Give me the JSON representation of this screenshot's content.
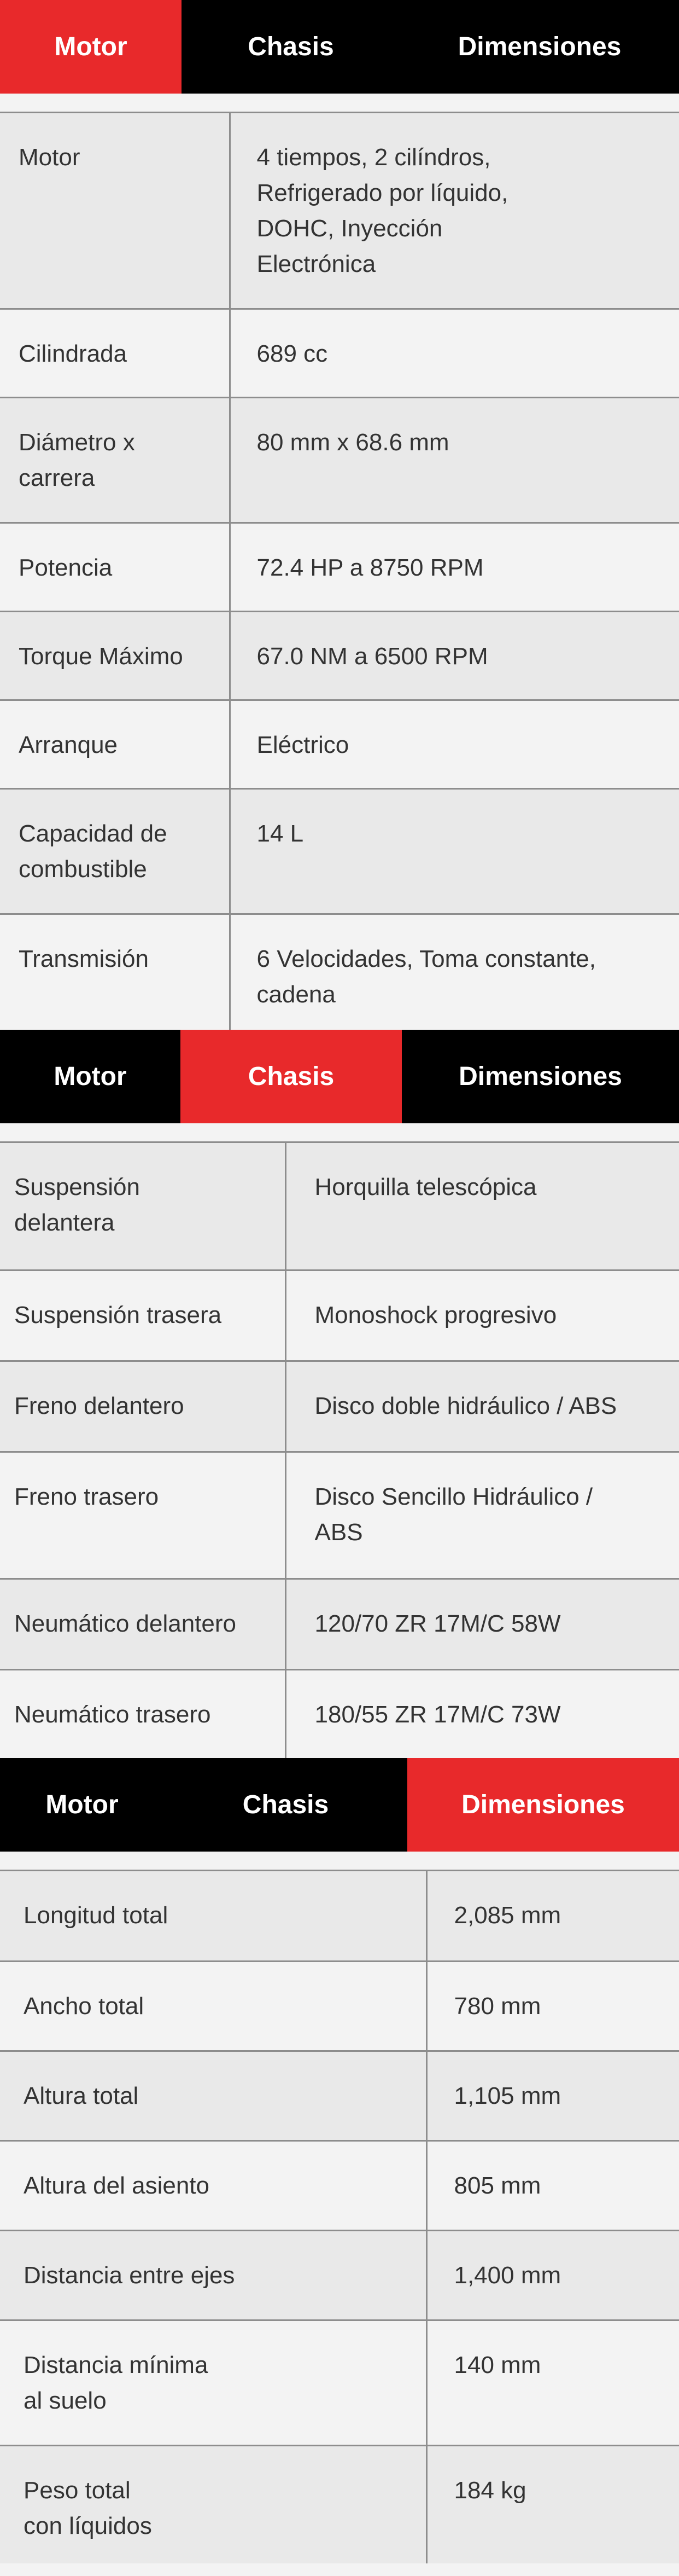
{
  "tabs": {
    "motor": "Motor",
    "chasis": "Chasis",
    "dimensiones": "Dimensiones"
  },
  "colors": {
    "active_tab": "#e8292b",
    "tab_bar": "#000000",
    "row_odd": "#e9e9e9",
    "row_even": "#f3f3f3",
    "divider": "#8d8d8d"
  },
  "motor": {
    "active_tab": "Motor",
    "rows": [
      {
        "label": "Motor",
        "value": "4 tiempos, 2 cilíndros,\nRefrigerado por líquido,\nDOHC, Inyección\nElectrónica"
      },
      {
        "label": "Cilindrada",
        "value": "689 cc"
      },
      {
        "label": "Diámetro x\ncarrera",
        "value": "80 mm x 68.6 mm"
      },
      {
        "label": "Potencia",
        "value": "72.4 HP a 8750 RPM"
      },
      {
        "label": "Torque Máximo",
        "value": "67.0 NM a 6500 RPM"
      },
      {
        "label": "Arranque",
        "value": "Eléctrico"
      },
      {
        "label": "Capacidad de\ncombustible",
        "value": "14 L"
      },
      {
        "label": "Transmisión",
        "value": "6 Velocidades, Toma constante,\ncadena"
      }
    ]
  },
  "chasis": {
    "active_tab": "Chasis",
    "rows": [
      {
        "label": "Suspensión\ndelantera",
        "value": "Horquilla telescópica"
      },
      {
        "label": "Suspensión trasera",
        "value": "Monoshock progresivo"
      },
      {
        "label": "Freno delantero",
        "value": "Disco doble hidráulico / ABS"
      },
      {
        "label": "Freno trasero",
        "value": "Disco Sencillo Hidráulico /\nABS"
      },
      {
        "label": "Neumático delantero",
        "value": "120/70 ZR 17M/C 58W"
      },
      {
        "label": "Neumático trasero",
        "value": "180/55 ZR 17M/C 73W"
      }
    ]
  },
  "dimensiones": {
    "active_tab": "Dimensiones",
    "rows": [
      {
        "label": "Longitud total",
        "value": "2,085 mm"
      },
      {
        "label": "Ancho total",
        "value": "780 mm"
      },
      {
        "label": "Altura total",
        "value": "1,105 mm"
      },
      {
        "label": "Altura del asiento",
        "value": "805 mm"
      },
      {
        "label": "Distancia entre ejes",
        "value": "1,400 mm"
      },
      {
        "label": "Distancia mínima\nal suelo",
        "value": "140 mm"
      },
      {
        "label": "Peso total\ncon líquidos",
        "value": "184 kg"
      }
    ]
  }
}
